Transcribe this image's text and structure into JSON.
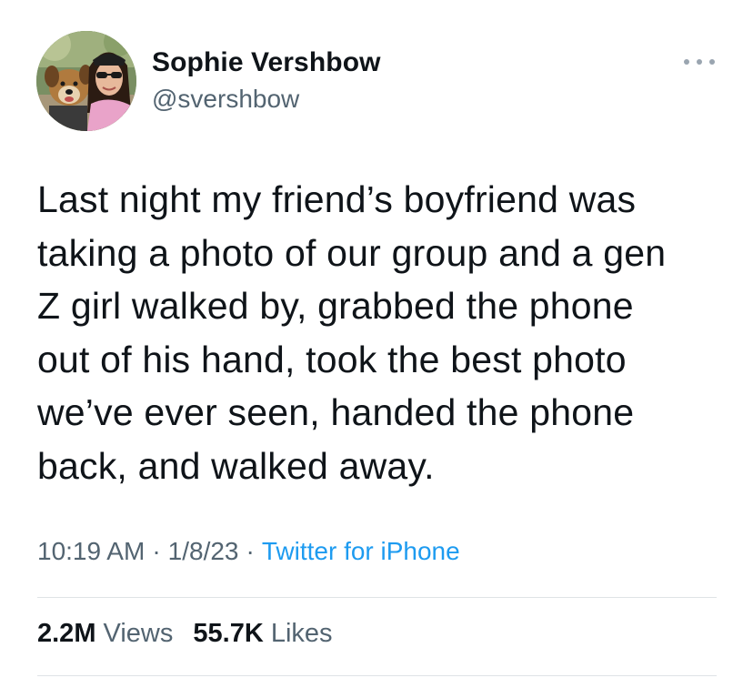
{
  "user": {
    "display_name": "Sophie Vershbow",
    "handle": "@svershbow",
    "avatar_icon": "profile-photo-woman-with-dog"
  },
  "tweet": {
    "text": "Last night my friend’s boyfriend was\ntaking a photo of our group and a gen\nZ girl walked by, grabbed the phone\nout of his hand, took the best photo\nwe’ve ever seen, handed the phone\nback, and walked away."
  },
  "meta": {
    "time": "10:19 AM",
    "separator": "·",
    "date": "1/8/23",
    "source": "Twitter for iPhone"
  },
  "stats": {
    "views_count": "2.2M",
    "views_label": "Views",
    "likes_count": "55.7K",
    "likes_label": "Likes"
  },
  "colors": {
    "text": "#0f1419",
    "secondary": "#536471",
    "link": "#1d9bf0",
    "divider": "#dfe3e6"
  }
}
